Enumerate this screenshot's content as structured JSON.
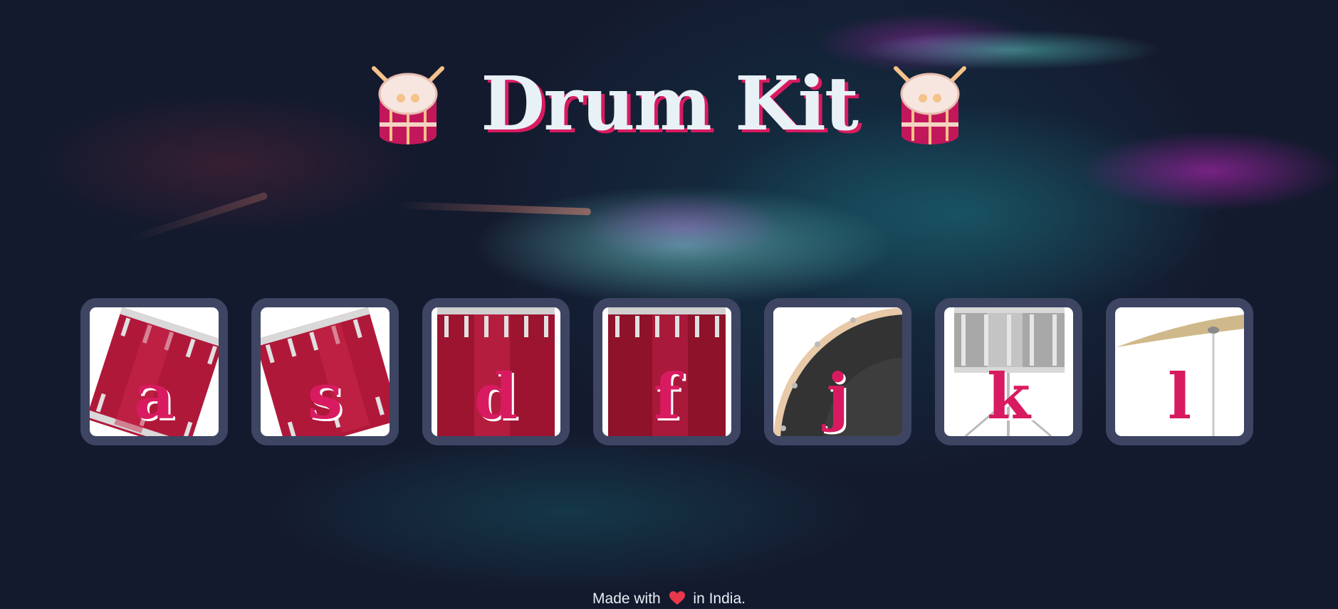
{
  "header": {
    "title": "Drum Kit",
    "left_icon": "drum-emoji-icon",
    "right_icon": "drum-emoji-icon"
  },
  "pads": [
    {
      "key": "a",
      "icon": "tom-drum-1"
    },
    {
      "key": "s",
      "icon": "tom-drum-2"
    },
    {
      "key": "d",
      "icon": "tom-drum-3"
    },
    {
      "key": "f",
      "icon": "tom-drum-4"
    },
    {
      "key": "j",
      "icon": "kick-drum"
    },
    {
      "key": "k",
      "icon": "snare-drum"
    },
    {
      "key": "l",
      "icon": "crash-cymbal"
    }
  ],
  "footer": {
    "before": "Made with",
    "heart_icon": "heart-icon",
    "after": "in India."
  },
  "colors": {
    "accent": "#d81b60",
    "title_text": "#e8f1f6",
    "pad_border": "#3d4563",
    "background": "#141a2e"
  }
}
